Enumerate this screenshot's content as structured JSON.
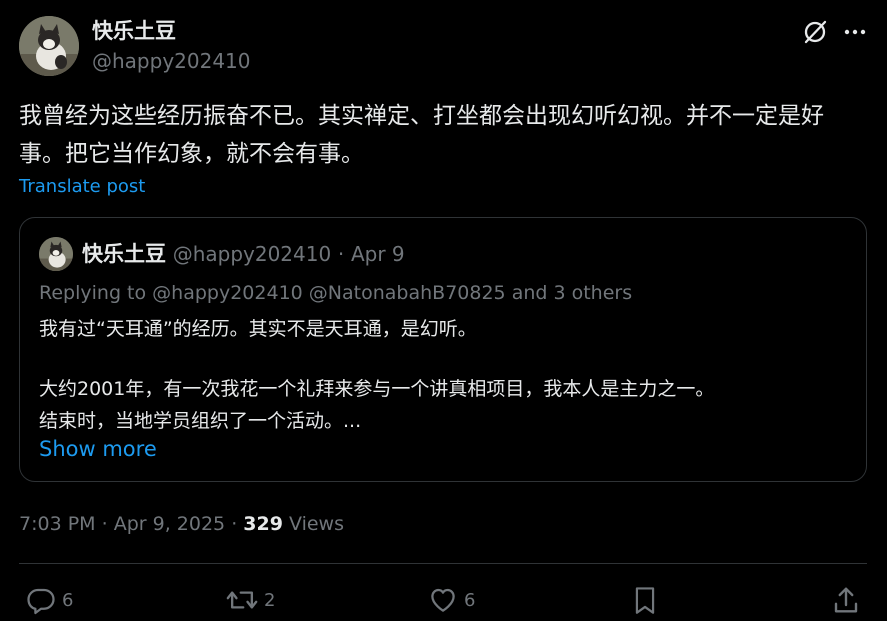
{
  "post": {
    "author_name": "快乐土豆",
    "author_handle": "@happy202410",
    "text": "我曾经为这些经历振奋不已。其实禅定、打坐都会出现幻听幻视。并不一定是好事。把它当作幻象，就不会有事。",
    "translate_label": "Translate post",
    "time": "7:03 PM",
    "date": "Apr 9, 2025",
    "views_count": "329",
    "views_label": "Views"
  },
  "quote": {
    "author_name": "快乐土豆",
    "author_handle": "@happy202410",
    "date": "Apr 9",
    "replying_prefix": "Replying to",
    "replying_users": "@happy202410 @NatonabahB70825",
    "replying_suffix": "and 3 others",
    "line1": "我有过“天耳通”的经历。其实不是天耳通，是幻听。",
    "line2": "大约2001年，有一次我花一个礼拜来参与一个讲真相项目，我本人是主力之一。",
    "line3": "结束时，当地学员组织了一个活动。...",
    "show_more": "Show more"
  },
  "actions": {
    "replies": "6",
    "reposts": "2",
    "likes": "6"
  },
  "icons": {
    "grok": "grok-icon",
    "more": "more-dots-icon",
    "reply": "reply-icon",
    "repost": "repost-icon",
    "like": "like-icon",
    "bookmark": "bookmark-icon",
    "share": "share-icon"
  },
  "colors": {
    "background": "#000000",
    "text": "#e7e9ea",
    "muted": "#71767b",
    "link": "#1d9bf0",
    "border": "#2f3336"
  }
}
